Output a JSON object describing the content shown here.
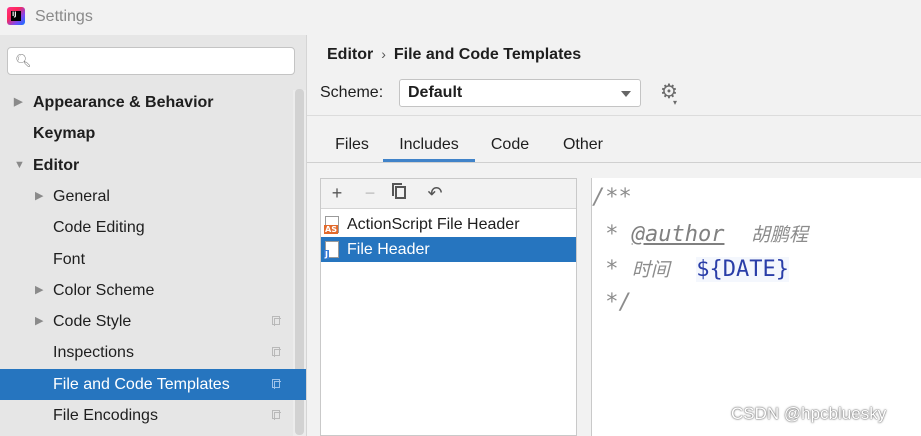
{
  "window": {
    "title": "Settings"
  },
  "sidebar": {
    "search_placeholder": "",
    "items": [
      {
        "label": "Appearance & Behavior",
        "bold": true,
        "expandable": true,
        "expanded": false,
        "level": 0
      },
      {
        "label": "Keymap",
        "bold": true,
        "expandable": false,
        "level": 0
      },
      {
        "label": "Editor",
        "bold": true,
        "expandable": true,
        "expanded": true,
        "level": 0
      },
      {
        "label": "General",
        "expandable": true,
        "expanded": false,
        "level": 1
      },
      {
        "label": "Code Editing",
        "level": 1
      },
      {
        "label": "Font",
        "level": 1
      },
      {
        "label": "Color Scheme",
        "expandable": true,
        "expanded": false,
        "level": 1
      },
      {
        "label": "Code Style",
        "expandable": true,
        "expanded": false,
        "level": 1,
        "copy_icon": true
      },
      {
        "label": "Inspections",
        "level": 1,
        "copy_icon": true
      },
      {
        "label": "File and Code Templates",
        "level": 1,
        "copy_icon": true,
        "selected": true
      },
      {
        "label": "File Encodings",
        "level": 1,
        "copy_icon": true
      }
    ]
  },
  "breadcrumb": {
    "parent": "Editor",
    "separator": "›",
    "current": "File and Code Templates"
  },
  "scheme": {
    "label": "Scheme:",
    "value": "Default"
  },
  "tabs": [
    {
      "label": "Files",
      "active": false
    },
    {
      "label": "Includes",
      "active": true
    },
    {
      "label": "Code",
      "active": false
    },
    {
      "label": "Other",
      "active": false
    }
  ],
  "toolbar": {
    "add": "+",
    "remove": "−",
    "revert": "↶"
  },
  "templates": [
    {
      "name": "ActionScript File Header",
      "badge": "AS",
      "selected": false
    },
    {
      "name": "File Header",
      "badge": "J",
      "selected": true
    }
  ],
  "editor": {
    "lines": [
      {
        "prefix": "/**"
      },
      {
        "prefix": " * ",
        "tag": "@author",
        "spacer": "  ",
        "text": "胡鹏程"
      },
      {
        "prefix": " * ",
        "text": "时间",
        "spacer": "  ",
        "var": "${DATE}"
      },
      {
        "prefix": " */"
      }
    ]
  },
  "watermark": "CSDN @hpcbluesky",
  "colors": {
    "selection": "#2675bf",
    "tab_underline": "#4083c9",
    "template_var": "#2a3ea8"
  }
}
